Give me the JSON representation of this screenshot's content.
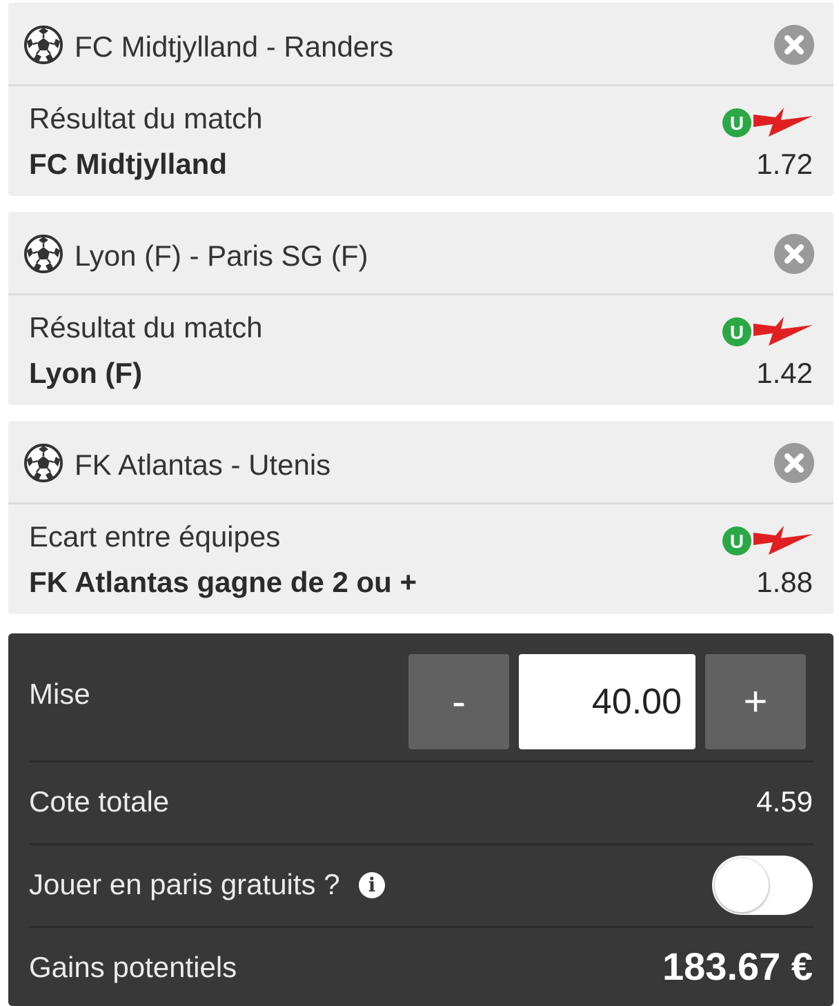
{
  "bets": [
    {
      "match": "FC Midtjylland - Randers",
      "market": "Résultat du match",
      "selection": "FC Midtjylland",
      "odds": "1.72",
      "sport_icon": "soccer-ball-icon"
    },
    {
      "match": "Lyon (F) - Paris SG (F)",
      "market": "Résultat du match",
      "selection": "Lyon (F)",
      "odds": "1.42",
      "sport_icon": "soccer-ball-icon"
    },
    {
      "match": "FK Atlantas - Utenis",
      "market": "Ecart entre équipes",
      "selection": "FK Atlantas gagne de 2 ou +",
      "odds": "1.88",
      "sport_icon": "soccer-ball-icon"
    }
  ],
  "stake": {
    "label": "Mise",
    "value": "40.00",
    "minus_label": "-",
    "plus_label": "+"
  },
  "total_odds": {
    "label": "Cote totale",
    "value": "4.59"
  },
  "free_bets": {
    "label": "Jouer en paris gratuits ?",
    "info_glyph": "i",
    "enabled": false
  },
  "potential_gains": {
    "label": "Gains potentiels",
    "value": "183.67 €"
  },
  "colors": {
    "card_bg": "#efefef",
    "panel_bg": "#383838",
    "close_icon": "#9a9a9a",
    "boost_logo_green": "#2aa845",
    "boost_logo_red": "#e02020"
  }
}
